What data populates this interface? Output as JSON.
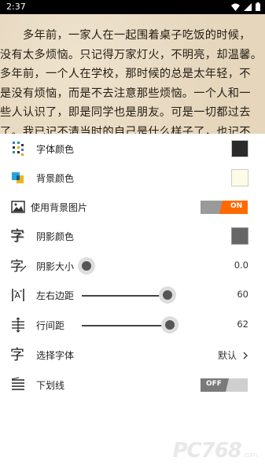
{
  "status_bar": {
    "time": "2:37"
  },
  "reader": {
    "lines": [
      "　　多年前，一家人在一起围着桌子吃饭的时候，",
      "没有太多烦恼。只记得万家灯火，不明亮，却温馨。",
      "多年前，一个人在学校，那时候的总是太年轻，不",
      "是没有烦恼，而是不去注意那些烦恼。一个人和一",
      "些人认识了，即是同学也是朋友。可是一切都过去",
      "了。我已记不清当时的自己是什么样子了，也记不"
    ]
  },
  "settings": {
    "font_color": {
      "label": "字体颜色",
      "color": "#2b2b2b"
    },
    "bg_color": {
      "label": "背景颜色",
      "color": "#fffce6"
    },
    "bg_image": {
      "label": "使用背景图片",
      "state": "ON"
    },
    "shadow_color": {
      "label": "阴影颜色",
      "color": "#666666"
    },
    "shadow_size": {
      "label": "阴影大小",
      "value": "0.0"
    },
    "margin": {
      "label": "左右边距",
      "value": "60",
      "fraction": 0.72
    },
    "line_spacing": {
      "label": "行间距",
      "value": "62",
      "fraction": 0.74
    },
    "font_family": {
      "label": "选择字体",
      "value": "默认"
    },
    "underline": {
      "label": "下划线",
      "state": "OFF"
    }
  },
  "colors": {
    "accent": "#ff6a00",
    "toggle_off": "#7a7a7a"
  },
  "watermark": {
    "text": "PC768",
    "sub": ".com"
  }
}
